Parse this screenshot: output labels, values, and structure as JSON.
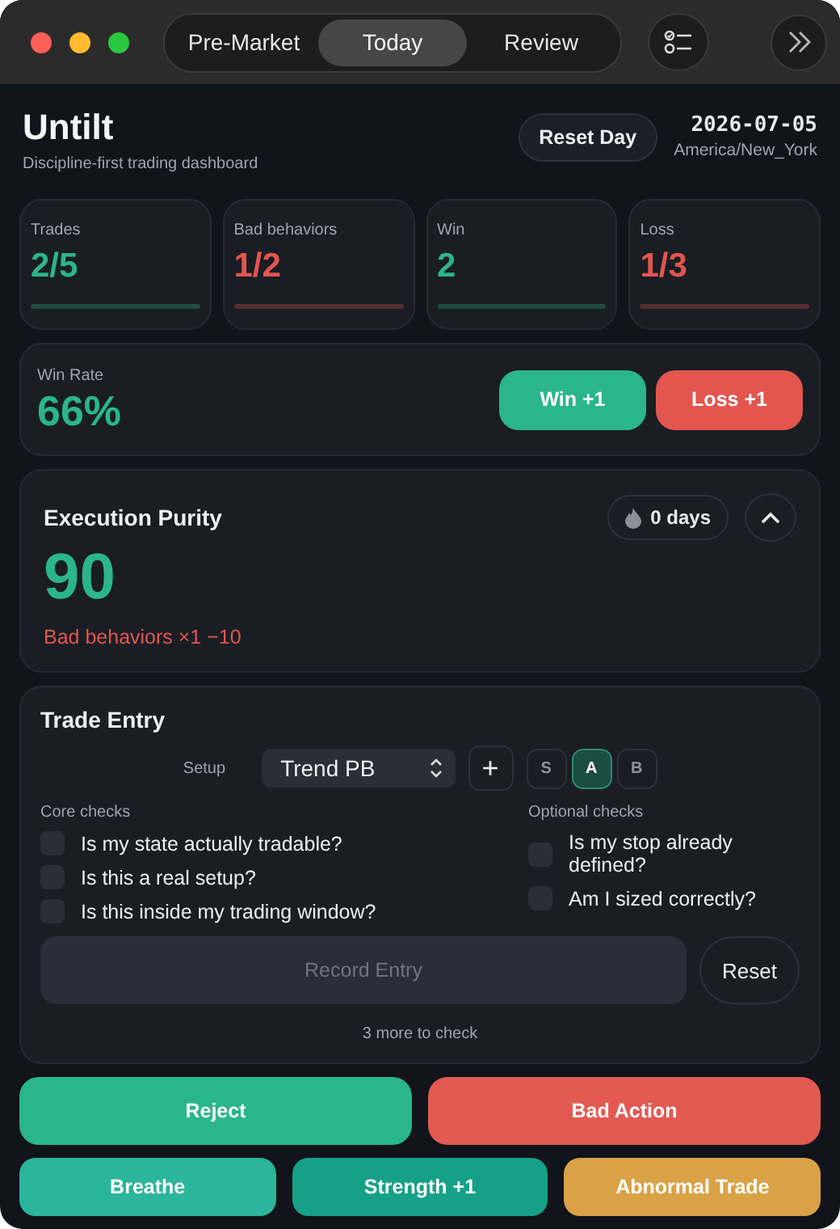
{
  "tabs": [
    {
      "label": "Pre-Market",
      "selected": false
    },
    {
      "label": "Today",
      "selected": true
    },
    {
      "label": "Review",
      "selected": false
    }
  ],
  "header": {
    "title": "Untilt",
    "subtitle": "Discipline-first trading dashboard",
    "reset_button": "Reset Day",
    "date": "2026-07-05",
    "timezone": "America/New_York"
  },
  "stats": [
    {
      "label": "Trades",
      "value": "2/5",
      "color": "#2bb58d"
    },
    {
      "label": "Bad behaviors",
      "value": "1/2",
      "color": "#e2564e"
    },
    {
      "label": "Win",
      "value": "2",
      "color": "#2bb58d"
    },
    {
      "label": "Loss",
      "value": "1/3",
      "color": "#e2564e"
    }
  ],
  "win_rate": {
    "label": "Win Rate",
    "value": "66%",
    "buttons": [
      {
        "label": "Win +1",
        "color": "#2bb58d"
      },
      {
        "label": "Loss +1",
        "color": "#e2564e"
      }
    ]
  },
  "purity": {
    "title": "Execution Purity",
    "streak": "0 days",
    "score": "90",
    "penalty": "Bad behaviors ×1 −10",
    "expanded": true
  },
  "trade_entry": {
    "title": "Trade Entry",
    "setup_label": "Setup",
    "setup_value": "Trend PB",
    "add": "+",
    "grades": [
      {
        "label": "S",
        "selected": false
      },
      {
        "label": "A",
        "selected": true
      },
      {
        "label": "B",
        "selected": false
      }
    ],
    "core_title": "Core checks",
    "core_checks": [
      {
        "label": "Is my state actually tradable?",
        "checked": false
      },
      {
        "label": "Is this a real setup?",
        "checked": false
      },
      {
        "label": "Is this inside my trading window?",
        "checked": false
      }
    ],
    "optional_title": "Optional checks",
    "optional_checks": [
      {
        "label": "Is my stop already defined?",
        "checked": false
      },
      {
        "label": "Am I sized correctly?",
        "checked": false
      }
    ],
    "record_button": {
      "label": "Record Entry",
      "disabled": true
    },
    "reset_button": "Reset",
    "hint": "3 more to check"
  },
  "actions": [
    {
      "label": "Reject",
      "color": "#29b68a"
    },
    {
      "label": "Bad Action",
      "color": "#e25a52"
    }
  ],
  "quick_actions": [
    {
      "label": "Breathe",
      "color": "#2bb59a"
    },
    {
      "label": "Strength +1",
      "color": "#17a088"
    },
    {
      "label": "Abnormal Trade",
      "color": "#daa247"
    }
  ]
}
